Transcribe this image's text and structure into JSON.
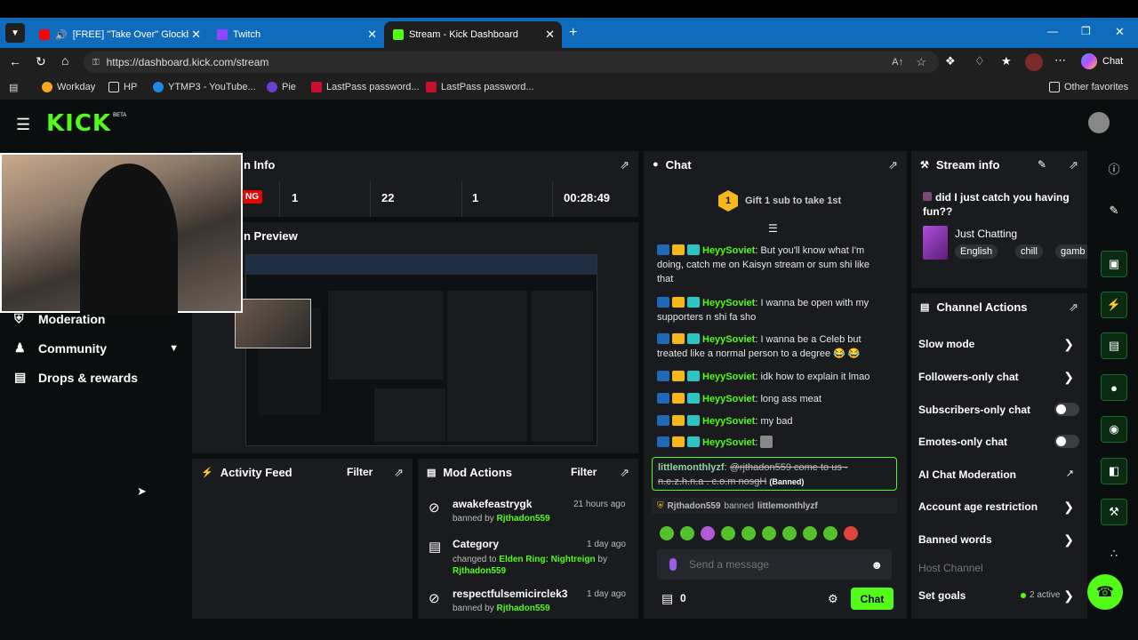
{
  "browser": {
    "tabs": [
      {
        "label": "[FREE] \"Take Over\" Glockboyz"
      },
      {
        "label": "Twitch"
      },
      {
        "label": "Stream - Kick Dashboard"
      }
    ],
    "url": "https://dashboard.kick.com/stream",
    "chat_label": "Chat",
    "bookmarks": [
      "Workday",
      "HP",
      "YTMP3 - YouTube...",
      "Pie",
      "LastPass password...",
      "LastPass password..."
    ],
    "other_favorites": "Other favorites"
  },
  "kick": {
    "logo": "KICK",
    "beta": "BETA",
    "session_title_partial": "n Info",
    "live_label": "NG",
    "stats": [
      "1",
      "22",
      "1",
      "00:28:49"
    ],
    "preview_title_partial": "n Preview",
    "nav": [
      "Moderation",
      "Community",
      "Drops & rewards"
    ]
  },
  "activity": {
    "title": "Activity Feed",
    "filter": "Filter"
  },
  "mod_actions": {
    "title": "Mod Actions",
    "filter": "Filter",
    "items": [
      {
        "name": "awakefeastrygk",
        "time": "21 hours ago",
        "line": "banned by",
        "by": "Rjthadon559"
      },
      {
        "name": "Category",
        "time": "1 day ago",
        "line": "changed to",
        "target": "Elden Ring: Nightreign",
        "by_word": "by",
        "by": "Rjthadon559"
      },
      {
        "name": "respectfulsemicirclek3",
        "time": "1 day ago",
        "line": "banned by",
        "by": "Rjthadon559"
      }
    ]
  },
  "chat": {
    "title": "Chat",
    "gift_num": "1",
    "gift": "Gift 1 sub to take 1st",
    "messages": [
      {
        "user": "HeyySoviet",
        "text": "But you'll know what I'm doing, catch me on Kaisyn stream or sum shi like that"
      },
      {
        "user": "HeyySoviet",
        "text": "I wanna be open with my supporters n shi fa sho"
      },
      {
        "user": "HeyySoviet",
        "text": "I wanna be a Celeb but treated like a normal person to a degree 😂 😂"
      },
      {
        "user": "HeyySoviet",
        "text": "idk how to explain it lmao"
      },
      {
        "user": "HeyySoviet",
        "text": "long ass meat"
      },
      {
        "user": "HeyySoviet",
        "text": "my bad"
      },
      {
        "user": "HeyySoviet",
        "text": ""
      }
    ],
    "banned_user": "littlemonthlyzf",
    "banned_text": "@rjthadon559 come to us - n.e.z.h.n.a . c.o.m nosgH",
    "banned_tag": "(Banned)",
    "ban_notice_by": "Rjthadon559",
    "ban_notice_word": "banned",
    "ban_notice_user": "littlemonthlyzf",
    "placeholder": "Send a message",
    "points": "0",
    "send": "Chat"
  },
  "stream_info": {
    "title": "Stream info",
    "stream_title": "did I just catch you having fun??",
    "category": "Just Chatting",
    "tags": [
      "English",
      "chill",
      "gamb"
    ]
  },
  "channel_actions": {
    "title": "Channel Actions",
    "items": [
      "Slow mode",
      "Followers-only chat",
      "Subscribers-only chat",
      "Emotes-only chat",
      "AI Chat Moderation",
      "Account age restriction",
      "Banned words"
    ],
    "host": "Host Channel",
    "goals": "Set goals",
    "goals_status": "2 active"
  },
  "colors": {
    "accent": "#53fc18",
    "panel": "#191b1f",
    "bg": "#0b0e0f",
    "tabbar": "#0f6cbd"
  }
}
